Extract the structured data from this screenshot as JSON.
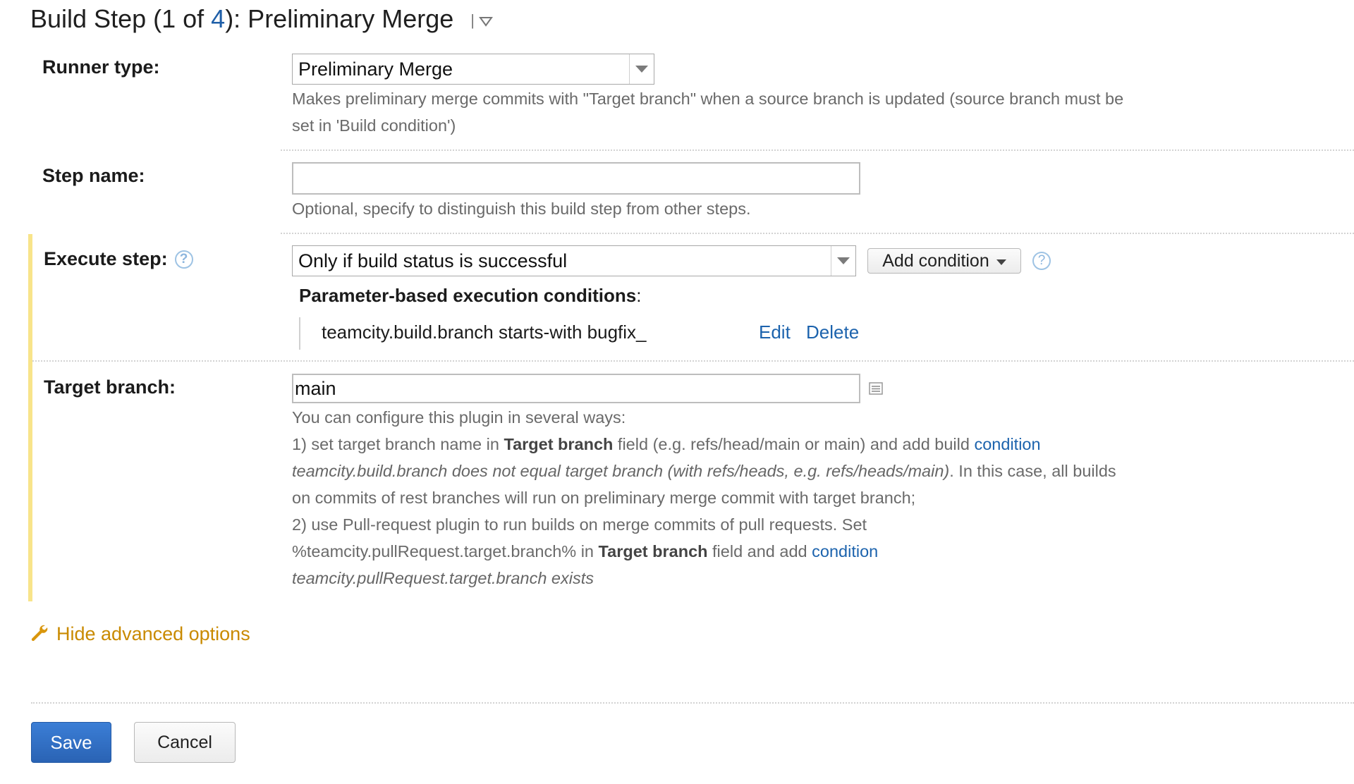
{
  "header": {
    "prefix": "Build Step (1 of ",
    "step_total": "4",
    "suffix": "): Preliminary Merge",
    "menu_icon": "dropdown-menu-icon"
  },
  "runner": {
    "label": "Runner type:",
    "value": "Preliminary Merge",
    "description_line1": "Makes preliminary merge commits with \"Target branch\" when a source branch is updated (source branch must be",
    "description_line2": "set in 'Build condition')"
  },
  "step_name": {
    "label": "Step name:",
    "value": "",
    "hint": "Optional, specify to distinguish this build step from other steps."
  },
  "execute": {
    "label": "Execute step:",
    "value": "Only if build status is successful",
    "add_condition_label": "Add condition",
    "conditions_heading": "Parameter-based execution conditions",
    "conditions_colon": ":",
    "conditions": [
      {
        "text": "teamcity.build.branch starts-with bugfix_",
        "edit": "Edit",
        "delete": "Delete"
      }
    ]
  },
  "target_branch": {
    "label": "Target branch:",
    "value": "main",
    "help_intro": "You can configure this plugin in several ways:",
    "line1_a": "1) set target branch name in ",
    "line1_b": "Target branch",
    "line1_c": " field (e.g. refs/head/main or main) and add build ",
    "line1_link": "condition",
    "line2_i": "teamcity.build.branch does not equal target branch (with refs/heads, e.g. refs/heads/main)",
    "line2_rest": ". In this case, all builds",
    "line3": "on commits of rest branches will run on preliminary merge commit with target branch;",
    "line4": "2) use Pull-request plugin to run builds on merge commits of pull requests. Set",
    "line5_a": "%teamcity.pullRequest.target.branch% in ",
    "line5_b": "Target branch",
    "line5_c": " field and add ",
    "line5_link": "condition",
    "line6_i": "teamcity.pullRequest.target.branch exists"
  },
  "advanced": {
    "label": "Hide advanced options",
    "icon": "wrench-icon"
  },
  "buttons": {
    "save": "Save",
    "cancel": "Cancel"
  },
  "colors": {
    "accent": "#2f6fc6",
    "link": "#1c63ad",
    "advanced": "#c98a00",
    "highlight_bar": "#f8e48a"
  }
}
